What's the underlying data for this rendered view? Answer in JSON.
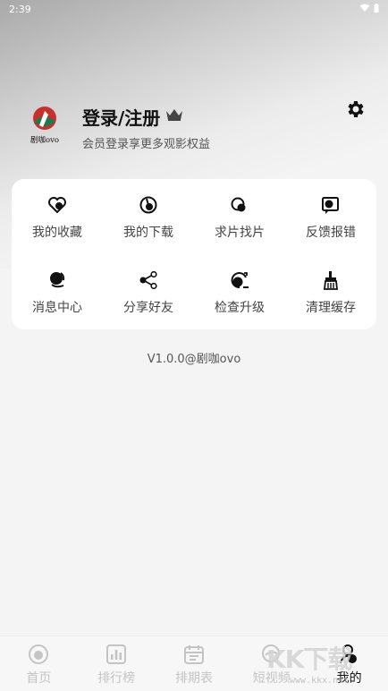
{
  "status_bar": {
    "time": "2:39"
  },
  "profile": {
    "title": "登录/注册",
    "subtitle": "会员登录享更多观影权益",
    "logo_text": "剧咖ovo"
  },
  "menu": {
    "items": [
      {
        "label": "我的收藏",
        "icon": "heart-icon"
      },
      {
        "label": "我的下载",
        "icon": "download-icon"
      },
      {
        "label": "求片找片",
        "icon": "search-film-icon"
      },
      {
        "label": "反馈报错",
        "icon": "feedback-icon"
      },
      {
        "label": "消息中心",
        "icon": "bell-icon"
      },
      {
        "label": "分享好友",
        "icon": "share-icon"
      },
      {
        "label": "检查升级",
        "icon": "upgrade-icon"
      },
      {
        "label": "清理缓存",
        "icon": "broom-icon"
      }
    ]
  },
  "version": "V1.0.0@剧咖ovo",
  "tabbar": {
    "tabs": [
      {
        "label": "首页",
        "icon": "home-icon"
      },
      {
        "label": "排行榜",
        "icon": "ranking-icon"
      },
      {
        "label": "排期表",
        "icon": "calendar-icon"
      },
      {
        "label": "短视频",
        "icon": "short-video-icon"
      },
      {
        "label": "我的",
        "icon": "profile-icon",
        "active": true
      }
    ]
  },
  "watermark": {
    "big": "KK下载",
    "small": "www.kkx.net"
  },
  "colors": {
    "text_dark": "#111111",
    "tab_inactive": "#c4c4c4",
    "card_bg": "#ffffff",
    "page_bg": "#f4f4f4"
  }
}
